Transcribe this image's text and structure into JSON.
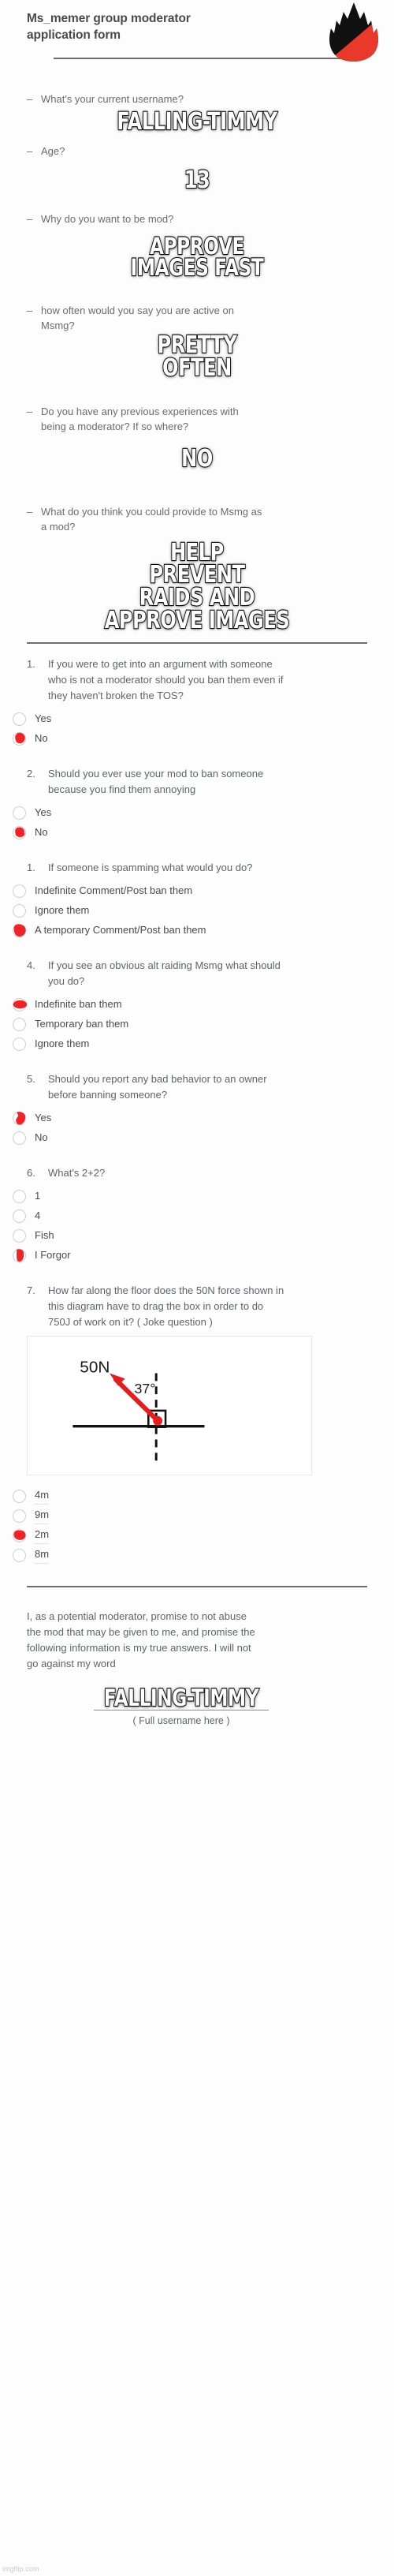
{
  "header": {
    "title": "Ms_memer group moderator application form",
    "logo": "imgflip-flame-logo"
  },
  "short_answers": [
    {
      "question": "What's your current username?",
      "answer": "FALLING-TIMMY"
    },
    {
      "question": "Age?",
      "answer": "13"
    },
    {
      "question": "Why do you want to be mod?",
      "answer": "APPROVE\nIMAGES FAST"
    },
    {
      "question": "how often would you say you are active on Msmg?",
      "answer": "PRETTY\nOFTEN"
    },
    {
      "question": "Do you have any previous experiences with being a moderator? If so where?",
      "answer": "NO"
    },
    {
      "question": "What do you think you could provide to Msmg as a mod?",
      "answer": "HELP\nPREVENT\nRAIDS AND\nAPPROVE IMAGES"
    }
  ],
  "multiple_choice": [
    {
      "number": "1.",
      "question": "If you were to get into an argument with someone who is not a moderator should you ban them even if they haven't broken the TOS?",
      "options": [
        {
          "label": "Yes",
          "selected": false
        },
        {
          "label": "No",
          "selected": true
        }
      ]
    },
    {
      "number": "2.",
      "question": "Should you ever use your mod to ban someone because you find them annoying",
      "options": [
        {
          "label": "Yes",
          "selected": false
        },
        {
          "label": "No",
          "selected": true
        }
      ]
    },
    {
      "number": "1.",
      "question": "If someone is spamming what would you do?",
      "options": [
        {
          "label": "Indefinite Comment/Post ban them",
          "selected": false
        },
        {
          "label": "Ignore them",
          "selected": false
        },
        {
          "label": "A temporary Comment/Post ban them",
          "selected": true
        }
      ]
    },
    {
      "number": "4.",
      "question": "If you see an obvious alt raiding Msmg what should you do?",
      "options": [
        {
          "label": "Indefinite ban them",
          "selected": true
        },
        {
          "label": "Temporary ban them",
          "selected": false
        },
        {
          "label": "Ignore them",
          "selected": false
        }
      ]
    },
    {
      "number": "5.",
      "question": "Should you report any bad behavior to an owner before banning someone?",
      "options": [
        {
          "label": "Yes",
          "selected": true
        },
        {
          "label": "No",
          "selected": false
        }
      ]
    },
    {
      "number": "6.",
      "question": "What's 2+2?",
      "options": [
        {
          "label": "1",
          "selected": false
        },
        {
          "label": "4",
          "selected": false
        },
        {
          "label": "Fish",
          "selected": false
        },
        {
          "label": "I Forgor",
          "selected": true
        }
      ]
    },
    {
      "number": "7.",
      "question": "How far along the floor does the 50N force shown in this diagram have to drag the box in order to do 750J of work on it? ( Joke question )",
      "options": [
        {
          "label": "4m",
          "selected": false,
          "underlined": true
        },
        {
          "label": "9m",
          "selected": false,
          "underlined": true
        },
        {
          "label": "2m",
          "selected": true,
          "underlined": true
        },
        {
          "label": "8m",
          "selected": false,
          "underlined": true
        }
      ]
    }
  ],
  "diagram": {
    "force_label": "50N",
    "angle_label": "37°",
    "arrow_color": "#e81c1c",
    "line_color": "#111111"
  },
  "footer": {
    "pledge": "I, as a potential moderator, promise to not abuse the mod that may be given to me, and promise the following information is my true answers. I will not go against my word",
    "signature": "FALLING-TIMMY",
    "signature_caption": "( Full username here )",
    "watermark": "imgflip.com"
  },
  "colors": {
    "accent_red": "#f02424",
    "logo_red": "#e8392b",
    "text_gray": "#5f6368",
    "divider": "#6d6d6d"
  }
}
